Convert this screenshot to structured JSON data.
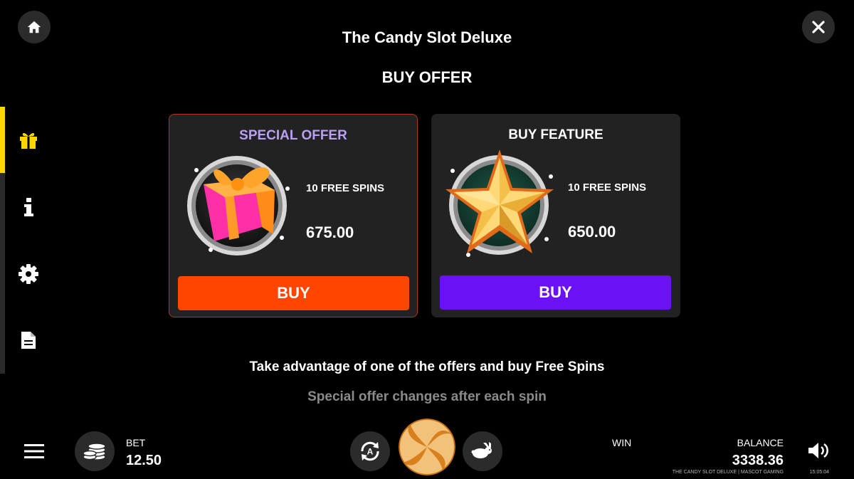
{
  "header": {
    "title": "The Candy Slot Deluxe",
    "section_title": "BUY OFFER"
  },
  "offers": [
    {
      "title": "SPECIAL OFFER",
      "spins": "10 FREE SPINS",
      "price": "675.00",
      "button": "BUY",
      "title_color": "#b9a0f5",
      "button_color": "#ff4500",
      "icon": "gift-icon"
    },
    {
      "title": "BUY FEATURE",
      "spins": "10 FREE SPINS",
      "price": "650.00",
      "button": "BUY",
      "title_color": "#ffffff",
      "button_color": "#6a12f5",
      "icon": "star-icon"
    }
  ],
  "description": {
    "line1": "Take advantage of one of the offers and buy Free Spins",
    "line2": "Special offer changes after each spin"
  },
  "sidebar": {
    "active_color": "#ffd700",
    "items": [
      "gift-icon",
      "info-icon",
      "gear-icon",
      "document-icon"
    ]
  },
  "bottom": {
    "bet_label": "BET",
    "bet_value": "12.50",
    "win_label": "WIN",
    "balance_label": "BALANCE",
    "balance_value": "3338.36",
    "footer": "THE CANDY SLOT DELUXE | MASCOT GAMING",
    "clock": "15:05:04"
  }
}
